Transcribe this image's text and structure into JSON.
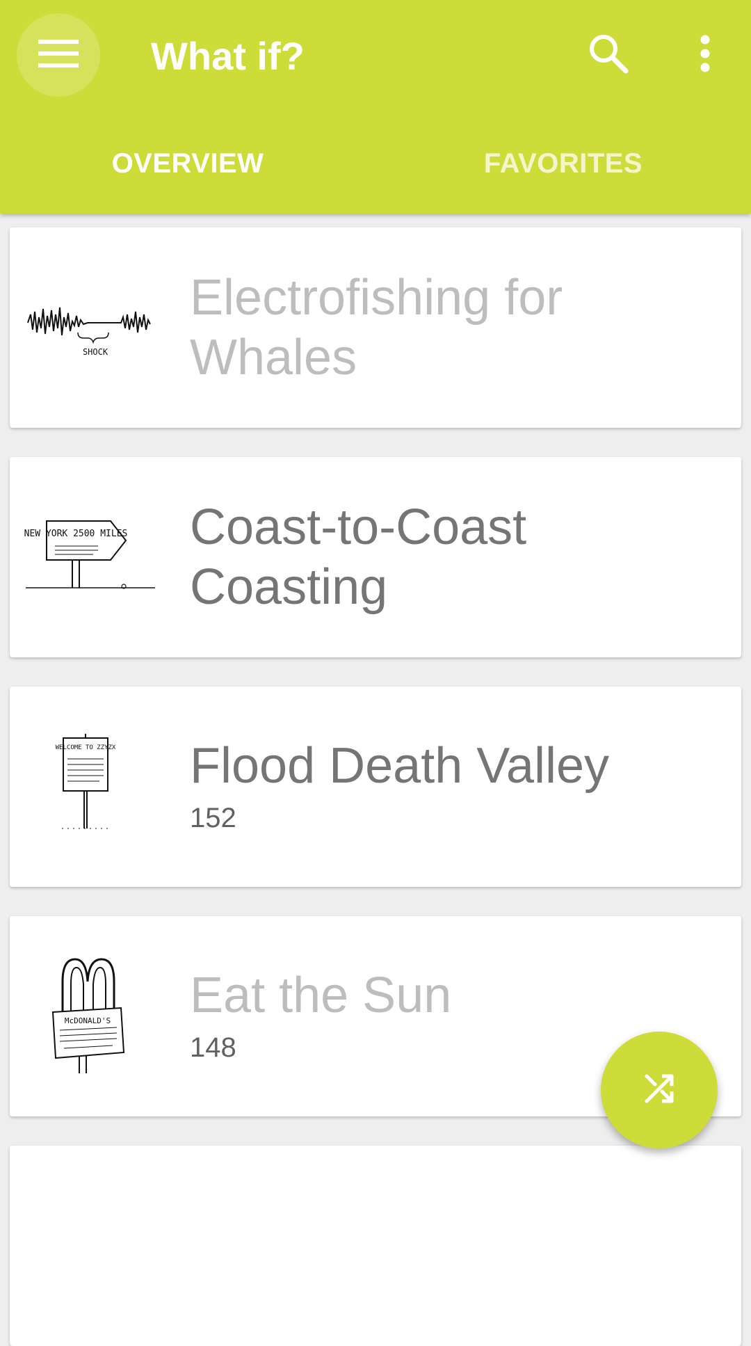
{
  "app": {
    "title": "What if?",
    "accent_color": "#cddc39",
    "icons": {
      "menu": "hamburger-menu-icon",
      "search": "search-icon",
      "more": "more-vert-icon",
      "fab": "shuffle-icon"
    }
  },
  "tabs": [
    {
      "label": "OVERVIEW",
      "selected": true
    },
    {
      "label": "FAVORITES",
      "selected": false
    }
  ],
  "articles": [
    {
      "title": "Electrofishing for Whales",
      "number": "",
      "read": true,
      "thumb_label": "SHOCK"
    },
    {
      "title": "Coast-to-Coast Coasting",
      "number": "",
      "read": false,
      "thumb_label": "NEW YORK 2500 MILES"
    },
    {
      "title": "Flood Death Valley",
      "number": "152",
      "read": false,
      "thumb_label": "WELCOME TO ZZYZX"
    },
    {
      "title": "Eat the Sun",
      "number": "148",
      "read": true,
      "thumb_label": "McDONALD'S"
    }
  ]
}
